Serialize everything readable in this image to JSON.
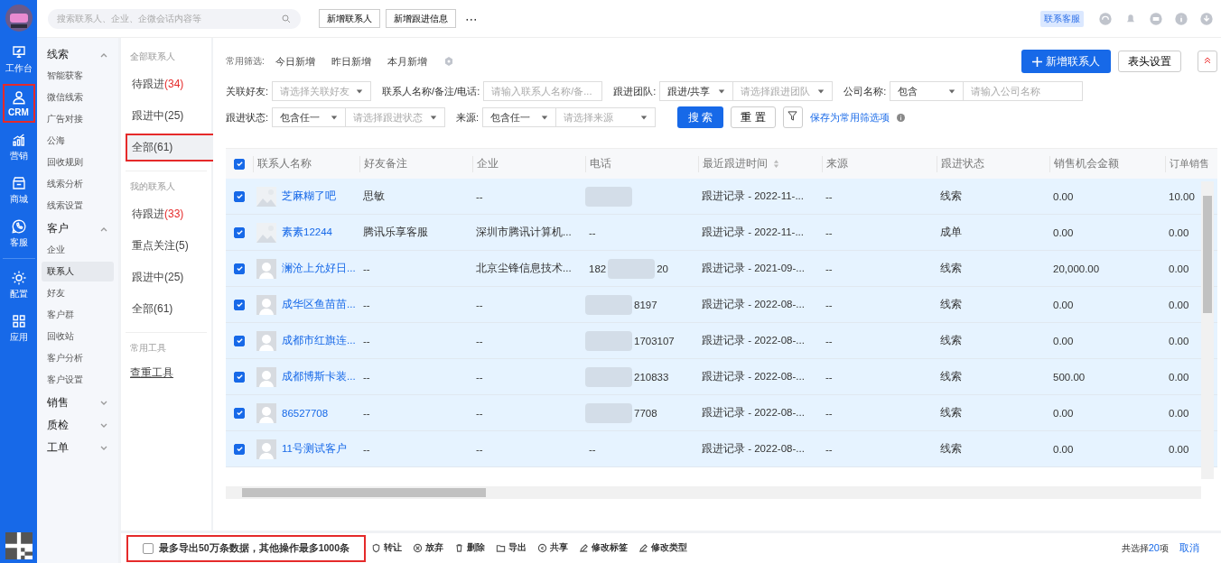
{
  "rail": {
    "items": [
      {
        "label": "工作台",
        "selected": false
      },
      {
        "label": "CRM",
        "selected": true
      },
      {
        "label": "营销",
        "selected": false
      },
      {
        "label": "商城",
        "selected": false
      },
      {
        "label": "客服",
        "selected": false
      },
      {
        "label": "配置",
        "selected": false
      },
      {
        "label": "应用",
        "selected": false
      }
    ]
  },
  "topbar": {
    "search": {
      "placeholder": "搜索联系人、企业、企微会话内容等"
    },
    "buttons": [
      "新增联系人",
      "新增跟进信息"
    ],
    "more": "⋯",
    "badge": "联系客服"
  },
  "nav": [
    {
      "label": "线索",
      "expanded": true,
      "children": [
        {
          "label": "智能获客",
          "selected": false
        },
        {
          "label": "微信线索",
          "selected": false
        },
        {
          "label": "广告对接",
          "selected": false
        },
        {
          "label": "公海",
          "selected": false
        },
        {
          "label": "回收规则",
          "selected": false
        },
        {
          "label": "线索分析",
          "selected": false
        },
        {
          "label": "线索设置",
          "selected": false
        }
      ]
    },
    {
      "label": "客户",
      "expanded": true,
      "children": [
        {
          "label": "企业",
          "selected": false
        },
        {
          "label": "联系人",
          "selected": true
        },
        {
          "label": "好友",
          "selected": false
        },
        {
          "label": "客户群",
          "selected": false
        },
        {
          "label": "回收站",
          "selected": false
        },
        {
          "label": "客户分析",
          "selected": false
        },
        {
          "label": "客户设置",
          "selected": false
        }
      ]
    },
    {
      "label": "销售",
      "expanded": false
    },
    {
      "label": "质检",
      "expanded": false
    },
    {
      "label": "工单",
      "expanded": false
    }
  ],
  "panel": [
    {
      "title": "全部联系人",
      "items": [
        {
          "label": "待跟进",
          "count": "(34)",
          "alert": true,
          "selected": false,
          "highlighted": false
        },
        {
          "label": "跟进中",
          "count": "(25)",
          "alert": false,
          "selected": false,
          "highlighted": false
        },
        {
          "label": "全部",
          "count": "(61)",
          "alert": false,
          "selected": true,
          "highlighted": true
        }
      ]
    },
    {
      "title": "我的联系人",
      "items": [
        {
          "label": "待跟进",
          "count": "(33)",
          "alert": true,
          "selected": false,
          "highlighted": false
        },
        {
          "label": "重点关注",
          "count": "(5)",
          "alert": false,
          "selected": false,
          "highlighted": false
        },
        {
          "label": "跟进中",
          "count": "(25)",
          "alert": false,
          "selected": false,
          "highlighted": false
        },
        {
          "label": "全部",
          "count": "(61)",
          "alert": false,
          "selected": false,
          "highlighted": false
        }
      ]
    }
  ],
  "tools": {
    "title": "常用工具",
    "items": [
      "查重工具"
    ]
  },
  "quick": {
    "label": "常用筛选:",
    "items": [
      "今日新增",
      "昨日新增",
      "本月新增"
    ],
    "actions": {
      "add": "新增联系人",
      "columns": "表头设置"
    }
  },
  "filters": [
    [
      {
        "label": "关联好友:",
        "controls": [
          {
            "kind": "select",
            "placeholder": "请选择关联好友"
          }
        ]
      },
      {
        "label": "联系人名称/备注/电话:",
        "controls": [
          {
            "kind": "input",
            "placeholder": "请输入联系人名称/备..."
          }
        ]
      },
      {
        "label": "跟进团队:",
        "controls": [
          {
            "kind": "select",
            "value": "跟进/共享"
          },
          {
            "kind": "select",
            "placeholder": "请选择跟进团队"
          }
        ]
      },
      {
        "label": "公司名称:",
        "controls": [
          {
            "kind": "select",
            "value": "包含"
          },
          {
            "kind": "input",
            "placeholder": "请输入公司名称"
          }
        ]
      }
    ],
    [
      {
        "label": "跟进状态:",
        "controls": [
          {
            "kind": "select",
            "value": "包含任一"
          },
          {
            "kind": "select",
            "placeholder": "请选择跟进状态"
          }
        ]
      },
      {
        "label": "来源:",
        "controls": [
          {
            "kind": "select",
            "value": "包含任一"
          },
          {
            "kind": "select",
            "placeholder": "请选择来源"
          }
        ]
      }
    ]
  ],
  "filter_actions": {
    "search": "搜 索",
    "reset": "重 置",
    "save": "保存为常用筛选项"
  },
  "table": {
    "all_checked": true,
    "columns": [
      "联系人名称",
      "好友备注",
      "企业",
      "电话",
      "最近跟进时间",
      "来源",
      "跟进状态",
      "销售机会金额",
      "订单销售"
    ],
    "rows": [
      {
        "selected": true,
        "photo": true,
        "name": "芝麻糊了吧",
        "remark": "思敏",
        "company": "--",
        "phone": {
          "redacted": true
        },
        "last": "跟进记录 - 2022-11-...",
        "source": "--",
        "status": "线索",
        "amount": "0.00",
        "order": "10.00"
      },
      {
        "selected": true,
        "photo": true,
        "name": "素素12244",
        "remark": "腾讯乐享客服",
        "company": "深圳市腾讯计算机...",
        "phone": {
          "prefix": "--",
          "redacted": false
        },
        "last": "跟进记录 - 2022-11-...",
        "source": "--",
        "status": "成单",
        "amount": "0.00",
        "order": "0.00"
      },
      {
        "selected": true,
        "photo": false,
        "name": "澜沧上允好日...",
        "remark": "--",
        "company": "北京尘锋信息技术...",
        "phone": {
          "prefix": "182",
          "suffix": "20",
          "redacted": true
        },
        "last": "跟进记录 - 2021-09-...",
        "source": "--",
        "status": "线索",
        "amount": "20,000.00",
        "order": "0.00"
      },
      {
        "selected": true,
        "photo": false,
        "name": "成华区鱼苗苗...",
        "remark": "--",
        "company": "--",
        "phone": {
          "suffix": "8197",
          "redacted": true
        },
        "last": "跟进记录 - 2022-08-...",
        "source": "--",
        "status": "线索",
        "amount": "0.00",
        "order": "0.00"
      },
      {
        "selected": true,
        "photo": false,
        "name": "成都市红旗连...",
        "remark": "--",
        "company": "--",
        "phone": {
          "suffix": "1703107",
          "redacted": true
        },
        "last": "跟进记录 - 2022-08-...",
        "source": "--",
        "status": "线索",
        "amount": "0.00",
        "order": "0.00"
      },
      {
        "selected": true,
        "photo": false,
        "name": "成都博斯卡装...",
        "remark": "--",
        "company": "--",
        "phone": {
          "suffix": "210833",
          "redacted": true
        },
        "last": "跟进记录 - 2022-08-...",
        "source": "--",
        "status": "线索",
        "amount": "500.00",
        "order": "0.00"
      },
      {
        "selected": true,
        "photo": false,
        "name": "86527708",
        "remark": "--",
        "company": "--",
        "phone": {
          "suffix": "7708",
          "redacted": true
        },
        "last": "跟进记录 - 2022-08-...",
        "source": "--",
        "status": "线索",
        "amount": "0.00",
        "order": "0.00"
      },
      {
        "selected": true,
        "photo": false,
        "name": "11号测试客户",
        "remark": "--",
        "company": "--",
        "phone": {
          "prefix": "--",
          "redacted": false
        },
        "last": "跟进记录 - 2022-08-...",
        "source": "--",
        "status": "线索",
        "amount": "0.00",
        "order": "0.00"
      }
    ]
  },
  "bulk": {
    "checked": false,
    "highlighted": true,
    "note": "最多导出50万条数据，其他操作最多1000条",
    "actions": [
      "转让",
      "放弃",
      "删除",
      "导出",
      "共享",
      "修改标签",
      "修改类型"
    ],
    "selected_prefix": "共选择",
    "selected_count": "20",
    "selected_suffix": "项",
    "cancel": "取消"
  }
}
